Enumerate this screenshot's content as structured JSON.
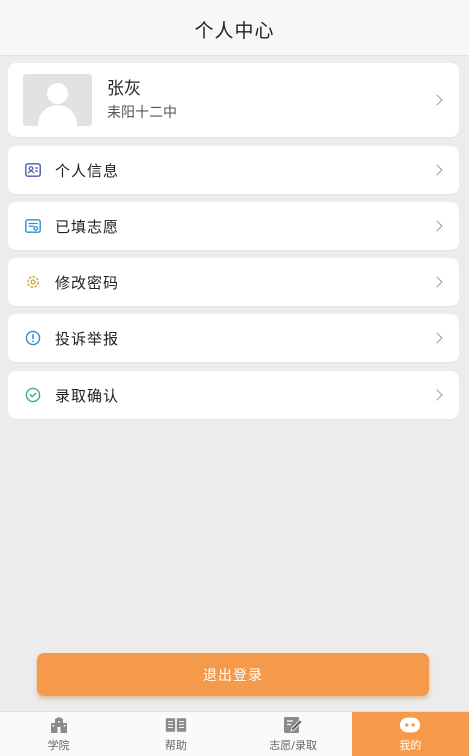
{
  "header": {
    "title": "个人中心"
  },
  "profile": {
    "name": "张灰",
    "school": "耒阳十二中"
  },
  "menu": [
    {
      "label": "个人信息",
      "icon": "id-card-icon",
      "color": "#4a5aa8"
    },
    {
      "label": "已填志愿",
      "icon": "form-list-icon",
      "color": "#2f8fc9"
    },
    {
      "label": "修改密码",
      "icon": "gear-icon",
      "color": "#c9a23a"
    },
    {
      "label": "投诉举报",
      "icon": "alert-icon",
      "color": "#2f8fc9"
    },
    {
      "label": "录取确认",
      "icon": "check-icon",
      "color": "#3fb07a"
    }
  ],
  "logout": {
    "label": "退出登录"
  },
  "tabbar": {
    "tabs": [
      {
        "label": "学院",
        "icon": "school-icon"
      },
      {
        "label": "帮助",
        "icon": "book-icon"
      },
      {
        "label": "志愿/录取",
        "icon": "edit-icon"
      },
      {
        "label": "我的",
        "icon": "chat-face-icon"
      }
    ],
    "active_index": 3
  },
  "colors": {
    "accent": "#f59a4a",
    "background": "#ececec"
  }
}
